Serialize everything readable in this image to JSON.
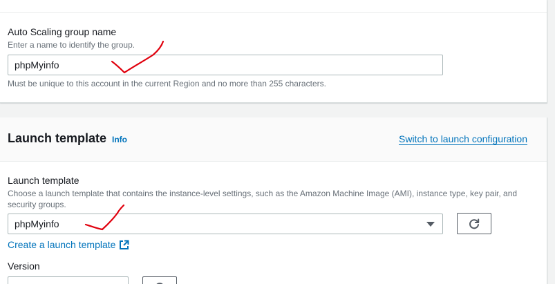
{
  "asg_name_section": {
    "label": "Auto Scaling group name",
    "description": "Enter a name to identify the group.",
    "input_value": "phpMyinfo",
    "constraint": "Must be unique to this account in the current Region and no more than 255 characters."
  },
  "launch_template_section": {
    "heading": "Launch template",
    "info_label": "Info",
    "switch_link": "Switch to launch configuration",
    "field_label": "Launch template",
    "field_description_line1": "Choose a launch template that contains the instance-level settings, such as the Amazon Machine Image (AMI), instance type, key pair, and",
    "field_description_line2": "security groups.",
    "selected_value": "phpMyinfo",
    "refresh_icon": "refresh-icon",
    "create_link": "Create a launch template",
    "create_link_icon": "external-link-icon",
    "version_label": "Version"
  },
  "colors": {
    "link": "#0073bb",
    "annotation": "#e0000d",
    "border": "#aab7b8"
  }
}
